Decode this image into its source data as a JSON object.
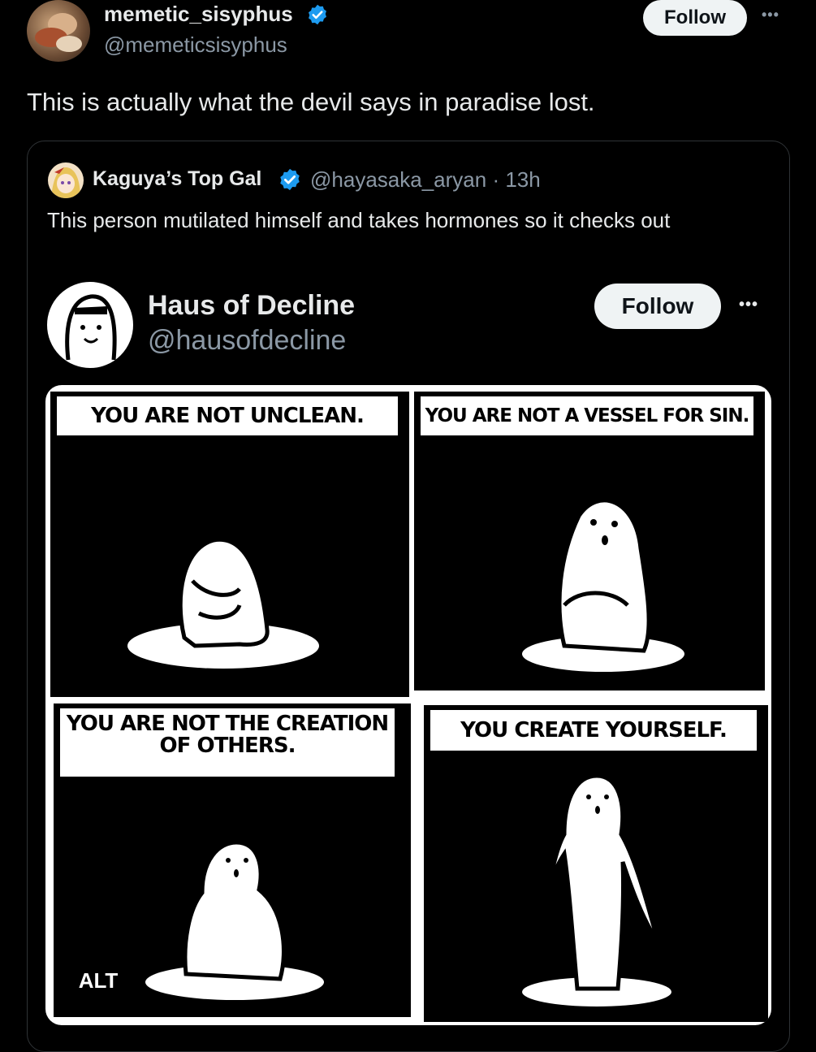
{
  "tweet": {
    "author_name": "memetic_sisyphus",
    "author_handle": "@memeticsisyphus",
    "follow_label": "Follow",
    "more_label": "•••",
    "text": "This is actually what the devil says in paradise lost."
  },
  "quoted": {
    "author_name": "Kaguya’s Top Gal",
    "author_handle": "@hayasaka_aryan",
    "separator": "·",
    "time": "13h",
    "text": "This person mutilated himself and takes hormones so it checks out"
  },
  "embedded": {
    "author_name": "Haus of Decline",
    "author_handle": "@hausofdecline",
    "follow_label": "Follow",
    "more_label": "•••"
  },
  "comic": {
    "panels": [
      {
        "caption": "YOU ARE NOT UNCLEAN."
      },
      {
        "caption": "YOU ARE NOT A VESSEL FOR SIN."
      },
      {
        "caption": "YOU ARE NOT THE CREATION OF OTHERS."
      },
      {
        "caption": "YOU CREATE YOURSELF."
      }
    ],
    "alt_label": "ALT"
  },
  "colors": {
    "background": "#000000",
    "verified": "#1d9bf0",
    "handle": "#8b98a5",
    "follow_bg": "#eff3f4"
  }
}
